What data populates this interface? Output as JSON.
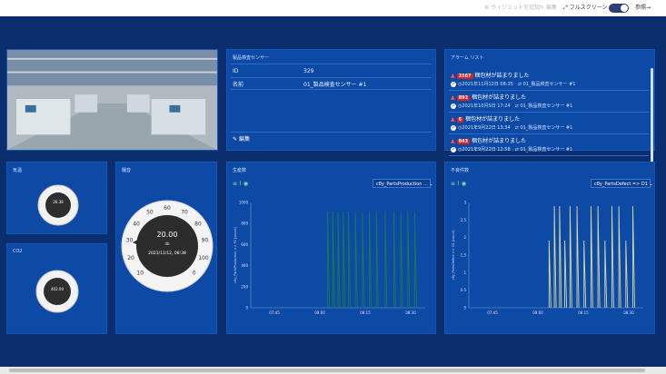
{
  "topbar": {
    "widget_settings": "ウィジェットを追加",
    "edit": "編集",
    "fullscreen": "フルスクリーン",
    "reference": "参照→"
  },
  "sensor": {
    "title": "製品検査センサー",
    "rows": [
      {
        "label": "ID",
        "value": "329"
      },
      {
        "label": "名前",
        "value": "01_製品検査センサー #1"
      }
    ],
    "edit": "編集"
  },
  "alarms": {
    "title": "アラーム リスト",
    "items": [
      {
        "badge": "2567",
        "text": "梱包材が詰まりました",
        "date": "2021年11月12日 08:35",
        "source": "01_製品検査センサー #1"
      },
      {
        "badge": "892",
        "text": "梱包材が詰まりました",
        "date": "2021年10月5日 17:24",
        "source": "01_製品検査センサー #1"
      },
      {
        "badge": "6",
        "text": "梱包材が詰まりました",
        "date": "2021年9月22日 13:34",
        "source": "01_製品検査センサー #1"
      },
      {
        "badge": "843",
        "text": "梱包材が詰まりました",
        "date": "2021年9月22日 12:58",
        "source": "01_製品検査センサー #1"
      }
    ]
  },
  "temp": {
    "title": "気温",
    "value": "26.38"
  },
  "co2": {
    "title": "CO2",
    "value": "402.00"
  },
  "noise": {
    "title": "騒音",
    "value": "20.00",
    "unit": "db",
    "timestamp": "2021/11/12, 08:38",
    "ticks": [
      "10",
      "20",
      "30",
      "40",
      "50",
      "60",
      "70",
      "80",
      "90",
      "100",
      "0"
    ]
  },
  "production": {
    "title": "生産数",
    "dropdown": "c8y_PartsProduction ...",
    "ylabel": "c8y_PartsProduction => P1 [count]",
    "yticks": [
      "1000",
      "800",
      "600",
      "400",
      "200",
      "0"
    ],
    "xticks": [
      "07:45",
      "08:00",
      "08:15",
      "08:30"
    ]
  },
  "defects": {
    "title": "不良件数",
    "dropdown": "c8y_PartsDefect => D1",
    "ylabel": "c8y_PartsDefect => D1 [count]",
    "yticks": [
      "3",
      "2.5",
      "2",
      "1.5",
      "1",
      "0.5",
      "0"
    ],
    "xticks": [
      "07:45",
      "08:00",
      "08:15",
      "08:30"
    ]
  },
  "colors": {
    "accent": "#0d4aa6",
    "bg": "#0b2f6e",
    "production_line": "#1a7a4c",
    "defect_line": "#d8d8a0",
    "alarm": "#e02020"
  }
}
